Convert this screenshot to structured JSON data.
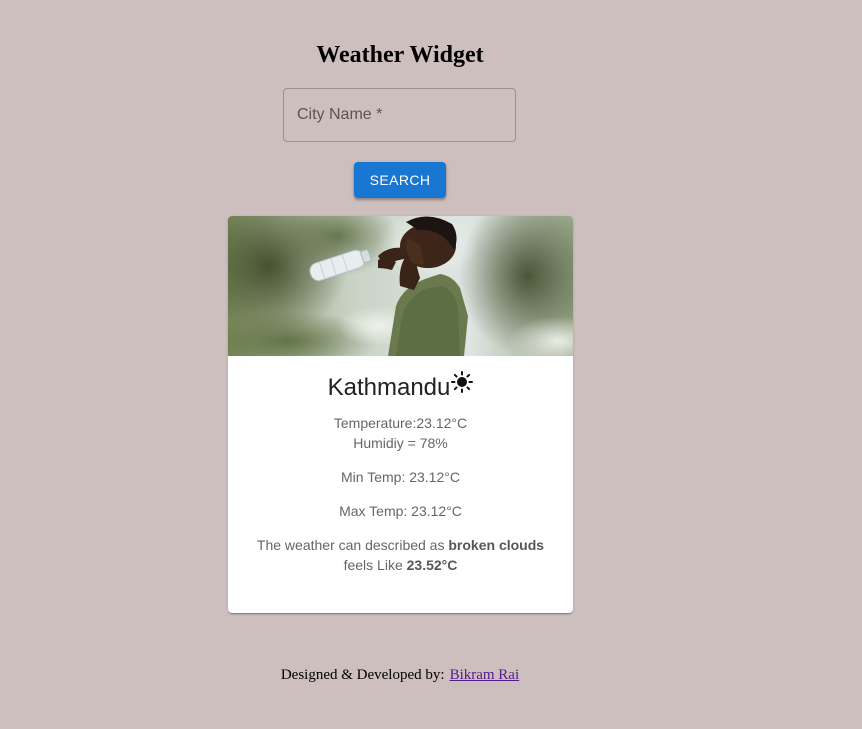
{
  "header": {
    "title": "Weather Widget"
  },
  "search": {
    "placeholder": "City Name *",
    "value": "",
    "button_label": "SEARCH"
  },
  "weather_card": {
    "city": "Kathmandu",
    "condition_icon": "sun-icon",
    "temperature_text": "Temperature:23.12°C",
    "humidity_text": "Humidiy = 78%",
    "min_temp_text": "Min Temp: 23.12°C",
    "max_temp_text": "Max Temp: 23.12°C",
    "description_prefix": "The weather can described as",
    "description": "broken clouds",
    "feels_like_prefix": "feels Like",
    "feels_like": "23.52°C"
  },
  "footer": {
    "credit_text": "Designed & Developed by:",
    "author_link": "Bikram Rai"
  },
  "colors": {
    "background": "#cdbfbe",
    "primary": "#1976d2",
    "link": "#551a8b"
  }
}
